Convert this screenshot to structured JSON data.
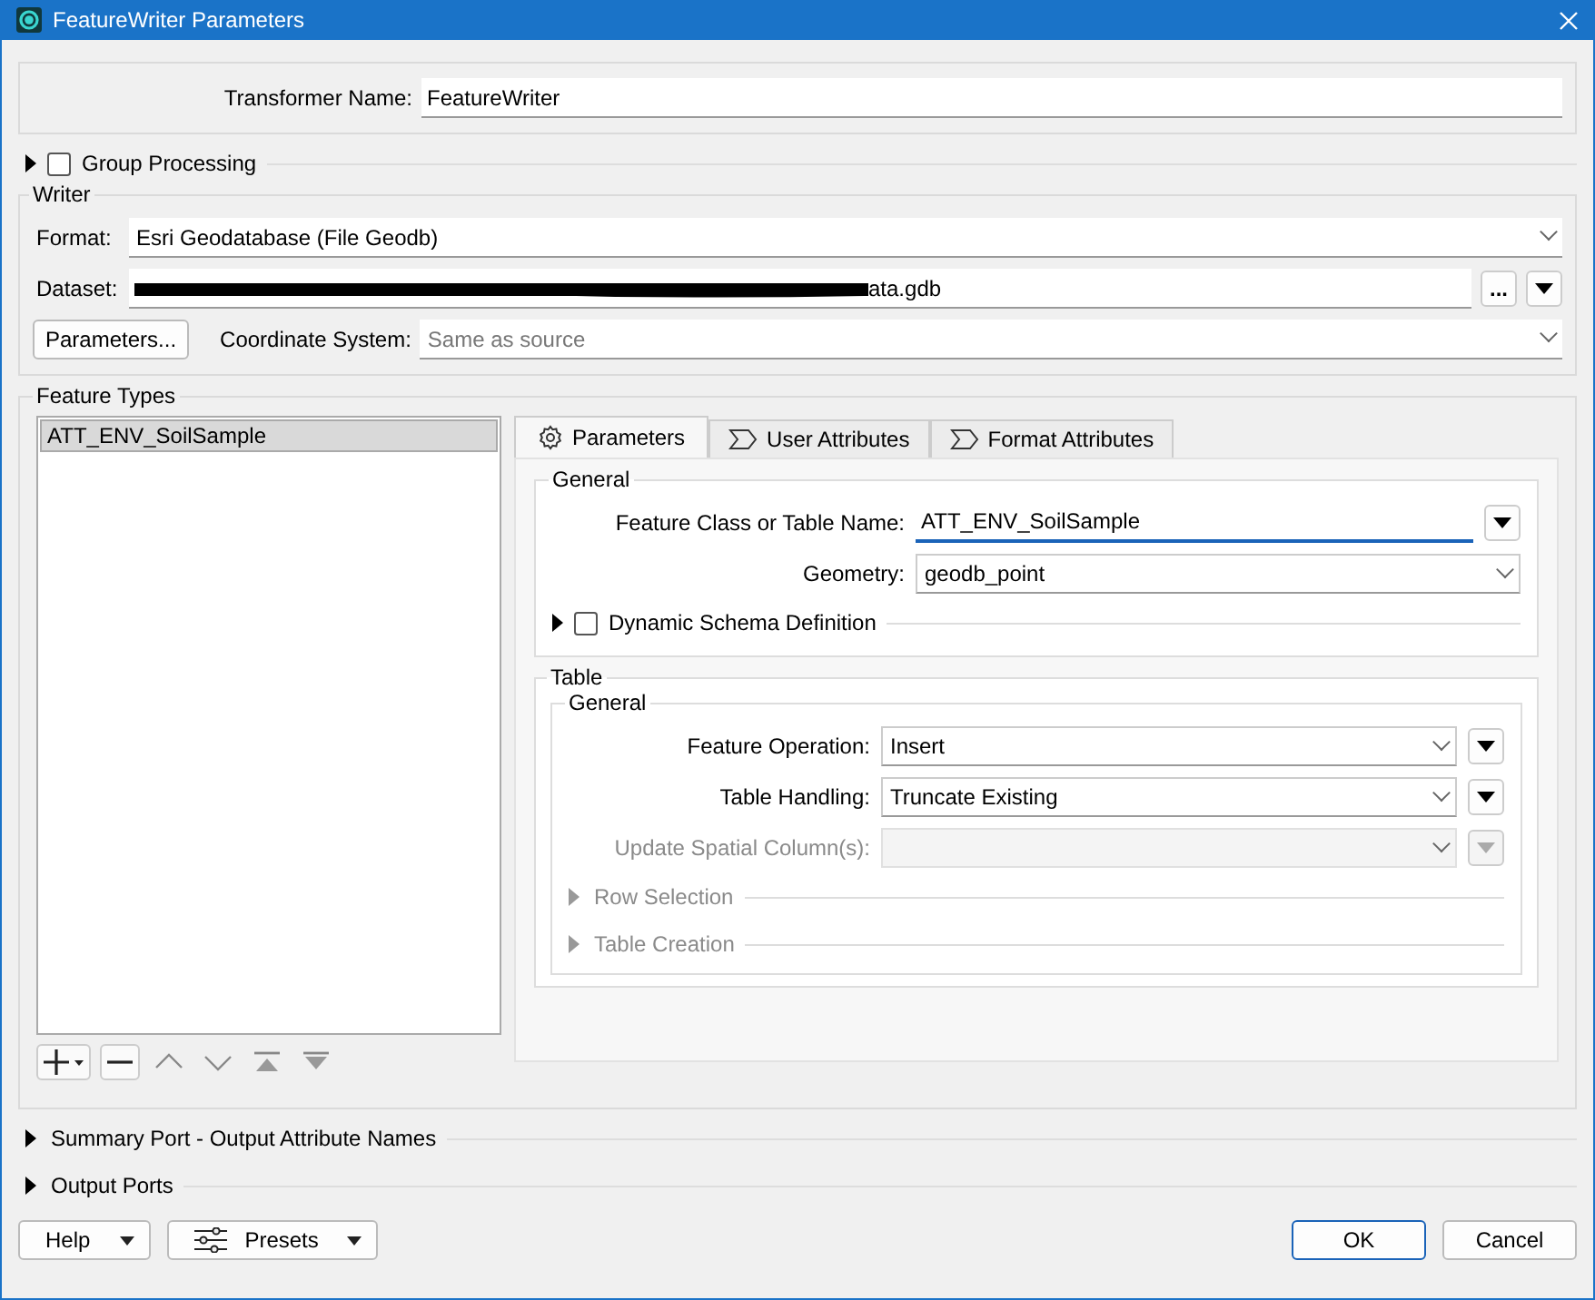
{
  "window": {
    "title": "FeatureWriter Parameters"
  },
  "transformer_name": {
    "label": "Transformer Name:",
    "value": "FeatureWriter"
  },
  "group_processing": {
    "label": "Group Processing",
    "expanded": false,
    "checked": false
  },
  "writer": {
    "title": "Writer",
    "format": {
      "label": "Format:",
      "value": "Esri Geodatabase (File Geodb)"
    },
    "dataset": {
      "label": "Dataset:",
      "value": "ata.gdb",
      "redacted": true,
      "browse_button": "..."
    },
    "parameters_button": "Parameters...",
    "coordinate_system": {
      "label": "Coordinate System:",
      "placeholder": "Same as source"
    }
  },
  "feature_types": {
    "title": "Feature Types",
    "items": [
      {
        "label": "ATT_ENV_SoilSample",
        "selected": true
      }
    ],
    "list_tools": [
      {
        "kind": "add",
        "disabled": false
      },
      {
        "kind": "remove",
        "disabled": false
      },
      {
        "kind": "up",
        "disabled": true
      },
      {
        "kind": "down",
        "disabled": true
      },
      {
        "kind": "top",
        "disabled": true
      },
      {
        "kind": "bottom",
        "disabled": true
      }
    ],
    "tabs": [
      {
        "label": "Parameters",
        "selected": true
      },
      {
        "label": "User Attributes",
        "selected": false
      },
      {
        "label": "Format Attributes",
        "selected": false
      }
    ],
    "general": {
      "title": "General",
      "fields": [
        {
          "kind": "text",
          "label": "Feature Class or Table Name:",
          "value": "ATT_ENV_SoilSample",
          "focused": true,
          "menu": true
        },
        {
          "kind": "select",
          "label": "Geometry:",
          "value": "geodb_point"
        }
      ],
      "sections": [
        {
          "label": "Dynamic Schema Definition",
          "checked": false,
          "expanded": false,
          "disabled": false
        }
      ]
    },
    "table": {
      "title": "Table",
      "general": {
        "title": "General",
        "fields": [
          {
            "kind": "select",
            "label": "Feature Operation:",
            "value": "Insert",
            "menu": true,
            "disabled": false
          },
          {
            "kind": "select",
            "label": "Table Handling:",
            "value": "Truncate Existing",
            "menu": true,
            "disabled": false
          },
          {
            "kind": "select",
            "label": "Update Spatial Column(s):",
            "menu": true,
            "disabled": true
          }
        ],
        "sections": [
          {
            "label": "Row Selection",
            "expanded": false,
            "disabled": true
          },
          {
            "label": "Table Creation",
            "expanded": false,
            "disabled": true
          }
        ]
      }
    }
  },
  "collapsed_sections": [
    {
      "label": "Summary Port - Output Attribute Names",
      "expanded": false
    },
    {
      "label": "Output Ports",
      "expanded": false
    }
  ],
  "buttons": [
    {
      "label": "Help",
      "kind": "menu"
    },
    {
      "label": "Presets",
      "kind": "presets"
    },
    {
      "label": "OK",
      "kind": "default"
    },
    {
      "label": "Cancel",
      "kind": "plain"
    }
  ]
}
